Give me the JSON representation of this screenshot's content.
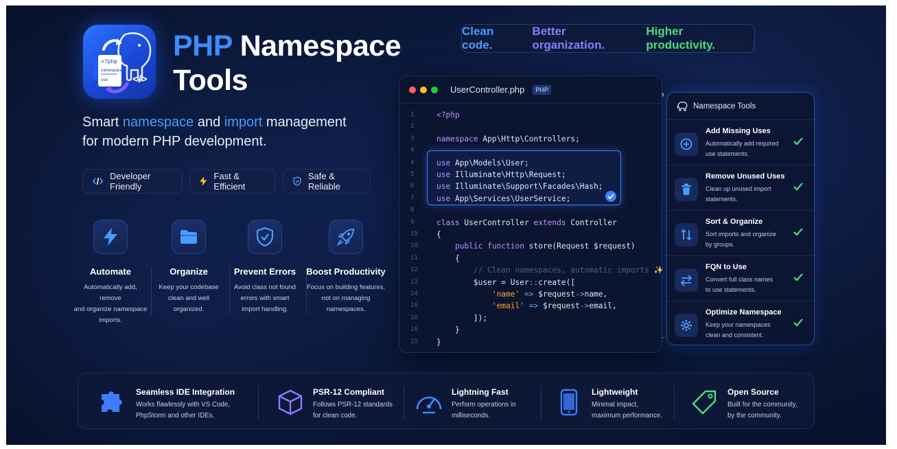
{
  "hero": {
    "title_prefix": "PHP",
    "title_rest": "Namespace",
    "title_line2": "Tools",
    "subtitle_a": "Smart ",
    "subtitle_b": "namespace",
    "subtitle_c": " and ",
    "subtitle_d": "import",
    "subtitle_e": " management",
    "subtitle_line2": "for modern PHP development."
  },
  "logo": {
    "code_text": "<?php",
    "line1": "namespace",
    "line2": "use"
  },
  "pills": [
    {
      "label": "Developer Friendly",
      "icon": "code-icon"
    },
    {
      "label": "Fast & Efficient",
      "icon": "bolt-icon"
    },
    {
      "label": "Safe & Reliable",
      "icon": "shield-icon"
    }
  ],
  "features": [
    {
      "title": "Automate",
      "desc1": "Automatically add, remove",
      "desc2": "and organize namespace",
      "desc3": "imports."
    },
    {
      "title": "Organize",
      "desc1": "Keep your codebase",
      "desc2": "clean and well",
      "desc3": "organized."
    },
    {
      "title": "Prevent Errors",
      "desc1": "Avoid class not found",
      "desc2": "errors with smart",
      "desc3": "import handling."
    },
    {
      "title": "Boost Productivity",
      "desc1": "Focus on building features,",
      "desc2": "not on managing",
      "desc3": "namespaces."
    }
  ],
  "tagline": {
    "part1": "Clean code.",
    "part2": "Better organization.",
    "part3": "Higher productivity."
  },
  "editor": {
    "filename": "UserController.php",
    "badge": "PHP",
    "lines": [
      {
        "n": "1",
        "code": "<?php"
      },
      {
        "n": "2",
        "code": ""
      },
      {
        "n": "3",
        "code": "namespace App\\Http\\Controllers;"
      },
      {
        "n": "4",
        "code": ""
      },
      {
        "n": "4",
        "code": "use App\\Models\\User;"
      },
      {
        "n": "5",
        "code": "use Illuminate\\Http\\Request;"
      },
      {
        "n": "6",
        "code": "use Illuminate\\Support\\Facades\\Hash;"
      },
      {
        "n": "7",
        "code": "use App\\Services\\UserService;"
      },
      {
        "n": "8",
        "code": ""
      },
      {
        "n": "9",
        "code": "class UserController extends Controller"
      },
      {
        "n": "19",
        "code": "{"
      },
      {
        "n": "10",
        "code": "    public function store(Request $request)"
      },
      {
        "n": "11",
        "code": "    {"
      },
      {
        "n": "12",
        "code": "        // Clean namespaces, automatic imports ✨"
      },
      {
        "n": "13",
        "code": "        $user = User::create(["
      },
      {
        "n": "14",
        "code": "            'name' => $request->name,"
      },
      {
        "n": "16",
        "code": "            'email' => $request->email,"
      },
      {
        "n": "16",
        "code": "        ]);"
      },
      {
        "n": "16",
        "code": "    }"
      },
      {
        "n": "15",
        "code": "}"
      }
    ]
  },
  "panel": {
    "title": "Namespace Tools",
    "items": [
      {
        "title": "Add Missing Uses",
        "desc1": "Automatically add required",
        "desc2": "use statements."
      },
      {
        "title": "Remove Unused Uses",
        "desc1": "Clean up unused import",
        "desc2": "statements."
      },
      {
        "title": "Sort & Organize",
        "desc1": "Sort imports and organize",
        "desc2": "by groups."
      },
      {
        "title": "FQN to Use",
        "desc1": "Convert full class names",
        "desc2": "to use statements."
      },
      {
        "title": "Optimize Namespace",
        "desc1": "Keep your namespaces",
        "desc2": "clean and consistent."
      }
    ]
  },
  "bottom": [
    {
      "title": "Seamless IDE Integration",
      "desc1": "Works flawlessly with VS Code,",
      "desc2": "PhpStorm and other IDEs."
    },
    {
      "title": "PSR-12 Compliant",
      "desc1": "Follows PSR-12 standards",
      "desc2": "for clean code."
    },
    {
      "title": "Lightning Fast",
      "desc1": "Perform operations in",
      "desc2": "milliseconds."
    },
    {
      "title": "Lightweight",
      "desc1": "Minimal impact,",
      "desc2": "maximum performance."
    },
    {
      "title": "Open Source",
      "desc1": "Built for the community,",
      "desc2": "by the community."
    }
  ],
  "colors": {
    "accent_blue": "#3d8bff",
    "accent_purple": "#8b7bff",
    "accent_green": "#4ade80",
    "keyword": "#b794ff",
    "string": "#f5a524",
    "comment": "#4f5d82"
  }
}
